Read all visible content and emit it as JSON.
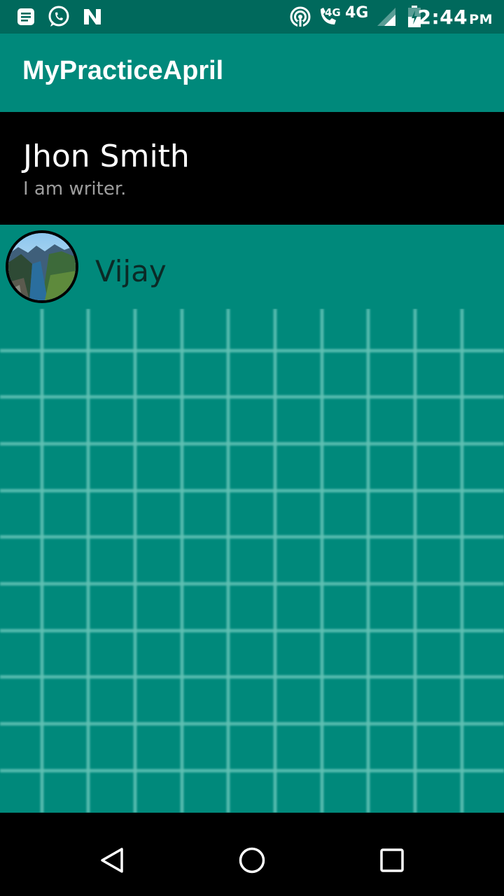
{
  "status_bar": {
    "time": "2:44",
    "ampm": "PM",
    "network_small": "4G",
    "network": "4G",
    "icons": [
      "message-icon",
      "whatsapp-icon",
      "n-icon",
      "hotspot-icon",
      "volte-call-icon",
      "signal-icon",
      "battery-icon"
    ]
  },
  "toolbar": {
    "title": "MyPracticeApril"
  },
  "profile": {
    "name": "Jhon Smith",
    "description": "I am writer."
  },
  "list": {
    "items": [
      {
        "name": "Vijay",
        "avatar": "mountain-landscape-avatar"
      }
    ]
  },
  "nav_bar": {
    "icons": [
      "back-icon",
      "home-icon",
      "recents-icon"
    ]
  },
  "colors": {
    "status_bar": "#00695c",
    "primary": "#00897b",
    "header_bg": "#000000",
    "grid_line": "#5fc1b4"
  }
}
